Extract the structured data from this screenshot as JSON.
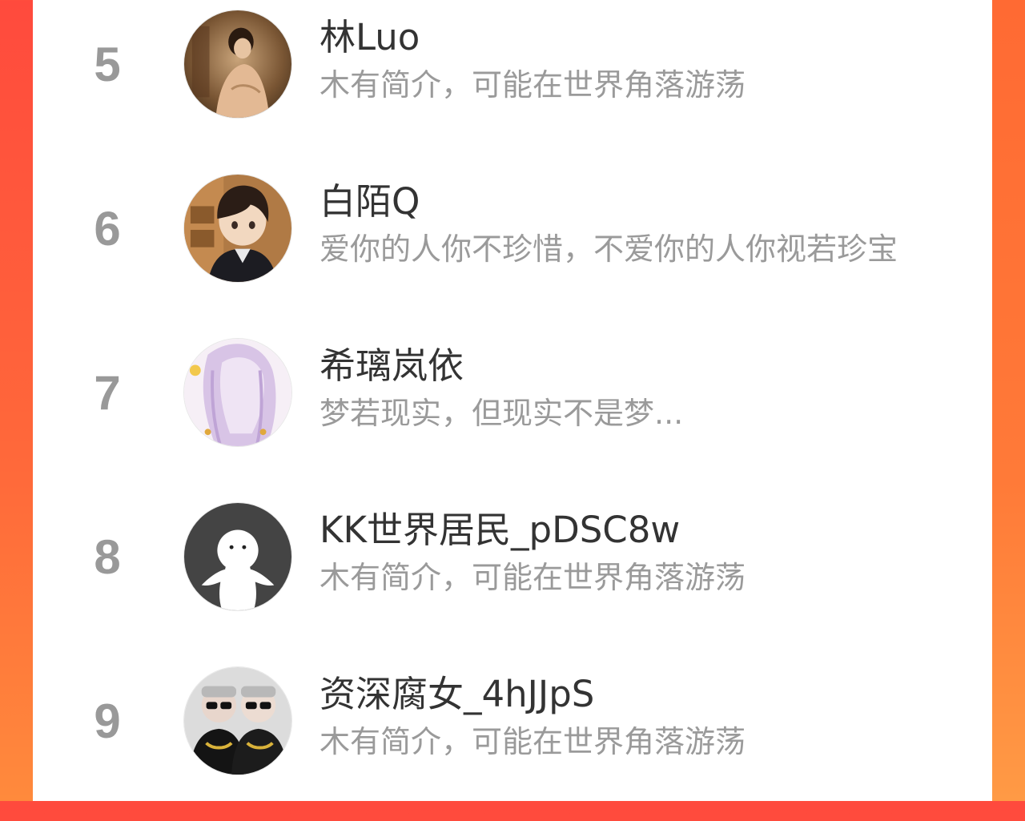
{
  "ranking": [
    {
      "rank": "5",
      "name": "林Luo",
      "bio": "木有简介，可能在世界角落游荡",
      "avatar": "avatar-woman-painting"
    },
    {
      "rank": "6",
      "name": "白陌Q",
      "bio": "爱你的人你不珍惜，不爱你的人你视若珍宝",
      "avatar": "avatar-anime-boy"
    },
    {
      "rank": "7",
      "name": "希璃岚依",
      "bio": "梦若现实，但现实不是梦...",
      "avatar": "avatar-anime-girl-lavender"
    },
    {
      "rank": "8",
      "name": "KK世界居民_pDSC8w",
      "bio": "木有简介，可能在世界角落游荡",
      "avatar": "avatar-default-silhouette"
    },
    {
      "rank": "9",
      "name": "资深腐女_4hJJpS",
      "bio": "木有简介，可能在世界角落游荡",
      "avatar": "avatar-two-people-sunglasses"
    }
  ],
  "colors": {
    "background_gradient_start": "#ff4a3d",
    "background_gradient_end": "#ff8a3c",
    "panel": "#ffffff",
    "rank_text": "#999999",
    "name_text": "#333333",
    "bio_text": "#9a9a9a"
  }
}
